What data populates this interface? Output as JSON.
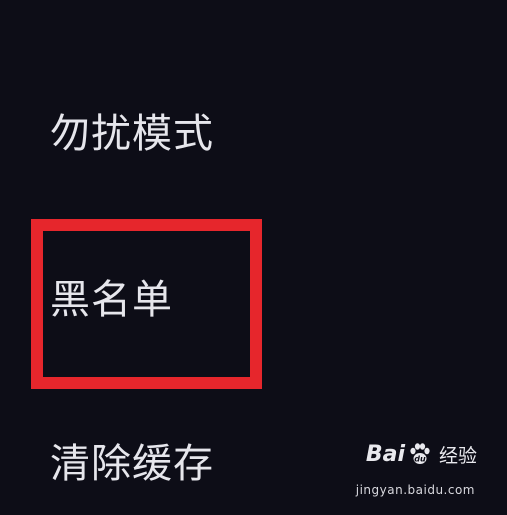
{
  "menu": {
    "items": [
      {
        "label": "勿扰模式"
      },
      {
        "label": "黑名单",
        "highlighted": true
      },
      {
        "label": "清除缓存"
      }
    ]
  },
  "highlight": {
    "color": "#e6262c"
  },
  "watermark": {
    "brand": "Bai",
    "brand_suffix": "du",
    "product": "经验",
    "url": "jingyan.baidu.com",
    "icon": "baidu-paw-icon"
  },
  "colors": {
    "background": "#0d0d17",
    "text": "#e6e6ec"
  }
}
